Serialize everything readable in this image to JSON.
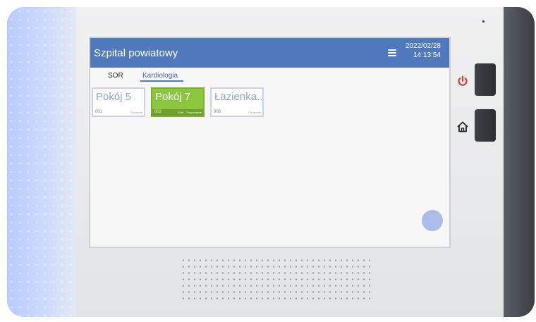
{
  "app": {
    "title": "Szpital powiatowy",
    "date": "2022/02/28",
    "time": "14:13:54"
  },
  "icons": {
    "menu": "hamburger-menu-icon",
    "power": "power-icon",
    "home": "home-icon"
  },
  "colors": {
    "appbar": "#4f78bd",
    "room_active": "#8cc63e",
    "power": "#e23b2e",
    "fab": "#a9bde8"
  },
  "tabs": [
    {
      "label": "SOR"
    },
    {
      "label": "Kardiologia",
      "active": true
    }
  ],
  "rooms": [
    {
      "name": "Pokój 5",
      "number": "001",
      "status": "Czuwanie"
    },
    {
      "name": "Pokój 7",
      "number": "002",
      "status": "Chel... Przywołanie"
    },
    {
      "name": "Łazienka...",
      "number": "003",
      "status": "Czuwanie"
    }
  ]
}
